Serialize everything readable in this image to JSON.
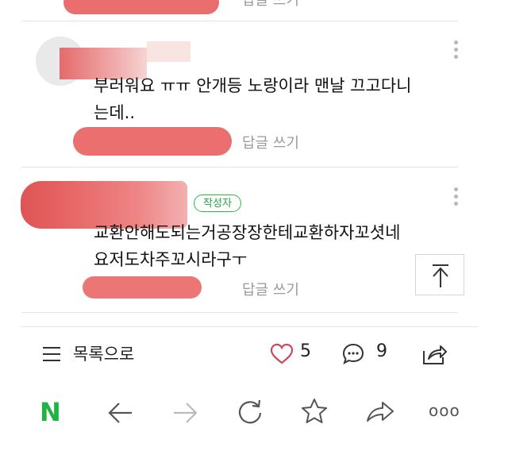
{
  "comments": [
    {
      "text": "",
      "reply_label": "답글 쓰기"
    },
    {
      "text": "부러워요 ㅠㅠ 안개등 노랑이라 맨날 끄고다니는데..",
      "line1": "부러워요 ㅠㅠ 안개등 노랑이라 맨날 끄고다니",
      "line2": "는데..",
      "reply_label": "답글 쓰기"
    },
    {
      "author_badge": "작성자",
      "line1": "교환안해도되는거공장장한테교환하자꼬셧네",
      "line2": "요저도차주꼬시라구ㅜ",
      "reply_label": "답글 쓰기"
    }
  ],
  "bottom_bar": {
    "list_label": "목록으로",
    "likes": "5",
    "comments_count": "9"
  },
  "browser_nav": {
    "logo": "N",
    "more": "ooo"
  },
  "colors": {
    "accent_green": "#1fb344",
    "heart": "#d0495a",
    "badge_green": "#2db84c"
  }
}
